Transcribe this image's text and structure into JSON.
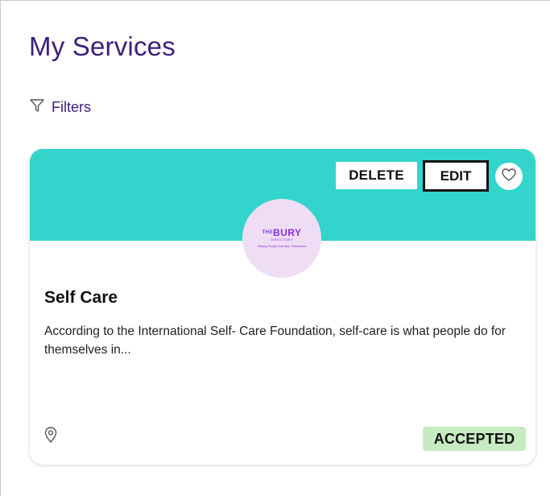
{
  "page": {
    "title": "My Services"
  },
  "filters": {
    "label": "Filters",
    "icon": "filter-funnel-icon"
  },
  "service_card": {
    "banner_color": "#33d4cc",
    "actions": {
      "delete_label": "DELETE",
      "edit_label": "EDIT",
      "favorite_icon": "heart-outline-icon"
    },
    "logo": {
      "prefix": "THE",
      "name": "BURY",
      "subtitle": "DIRECTORY",
      "tagline": "Helping People Look After Themselves"
    },
    "title": "Self Care",
    "description": "According to the International Self- Care Foundation, self-care is what people do for themselves in...",
    "location_icon": "map-pin-icon",
    "status": "ACCEPTED",
    "status_color": "#c6ebc1"
  },
  "colors": {
    "title": "#3b1f7a",
    "accent": "#33d4cc",
    "logo_bg": "#eeddf5",
    "logo_text": "#8a2be2"
  }
}
